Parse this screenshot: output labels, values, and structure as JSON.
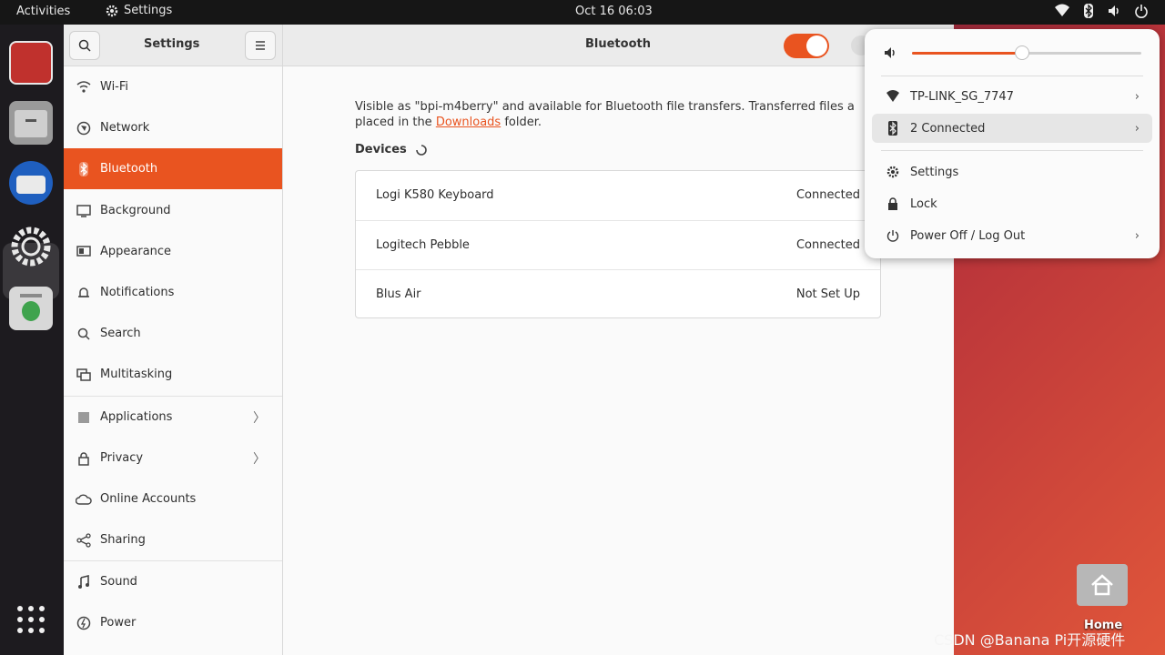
{
  "topbar": {
    "activities": "Activities",
    "app_name": "Settings",
    "clock": "Oct 16  06:03",
    "status_icons": [
      "wifi-icon",
      "bluetooth-icon",
      "volume-icon",
      "power-icon"
    ]
  },
  "dock": {
    "apps": [
      "screenshot-app-icon",
      "files-icon",
      "thunderbird-icon",
      "settings-icon",
      "trash-icon"
    ],
    "grid_icon": "app-grid-icon"
  },
  "window": {
    "sidebar_title": "Settings",
    "main_title": "Bluetooth",
    "bluetooth_enabled": true,
    "accent": "#e95420"
  },
  "sidebar": {
    "items": [
      {
        "label": "Wi-Fi",
        "icon": "wifi-icon"
      },
      {
        "label": "Network",
        "icon": "network-icon"
      },
      {
        "label": "Bluetooth",
        "icon": "bluetooth-icon",
        "active": true
      },
      {
        "label": "Background",
        "icon": "background-icon"
      },
      {
        "label": "Appearance",
        "icon": "appearance-icon"
      },
      {
        "label": "Notifications",
        "icon": "bell-icon"
      },
      {
        "label": "Search",
        "icon": "search-icon"
      },
      {
        "label": "Multitasking",
        "icon": "multitasking-icon"
      },
      {
        "label": "Applications",
        "icon": "applications-icon",
        "chevron": "〉"
      },
      {
        "label": "Privacy",
        "icon": "lock-icon",
        "chevron": "〉"
      },
      {
        "label": "Online Accounts",
        "icon": "cloud-icon"
      },
      {
        "label": "Sharing",
        "icon": "share-icon"
      },
      {
        "label": "Sound",
        "icon": "music-note-icon"
      },
      {
        "label": "Power",
        "icon": "power-icon"
      }
    ]
  },
  "content": {
    "info_prefix": "Visible as \"bpi-m4berry\" and available for Bluetooth file transfers. Transferred files a",
    "info_line2_prefix": "placed in the ",
    "info_link": "Downloads",
    "info_line2_suffix": " folder.",
    "devices_heading": "Devices",
    "devices": [
      {
        "name": "Logi K580 Keyboard",
        "status": "Connected"
      },
      {
        "name": "Logitech Pebble",
        "status": "Connected"
      },
      {
        "name": "Blus Air",
        "status": "Not Set Up"
      }
    ]
  },
  "popover": {
    "volume_level": 0.48,
    "wifi_label": "TP-LINK_SG_7747",
    "bluetooth_label": "2 Connected",
    "settings_label": "Settings",
    "lock_label": "Lock",
    "power_label": "Power Off / Log Out"
  },
  "desktop": {
    "home_label": "Home",
    "watermark": "CSDN @Banana Pi开源硬件"
  }
}
